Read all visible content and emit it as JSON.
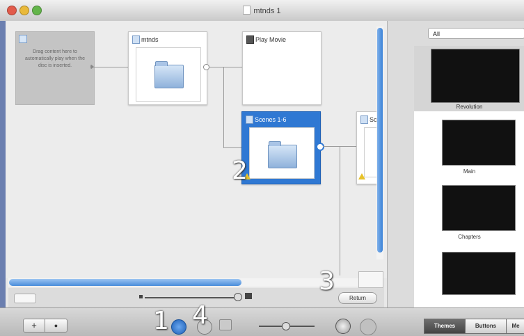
{
  "window": {
    "title": "mtnds 1"
  },
  "graph": {
    "placeholder_text": "Drag content here to automatically play when the disc is inserted.",
    "nodes": [
      {
        "label": "mtnds"
      },
      {
        "label": "Play Movie"
      },
      {
        "label": "Scenes 1-6"
      },
      {
        "label": "Sc"
      }
    ],
    "overlay_numbers": [
      "1",
      "2",
      "3",
      "4"
    ]
  },
  "zoombar": {
    "return_label": "Return"
  },
  "panel": {
    "filter_value": "All",
    "themes": [
      {
        "name": "Revolution"
      },
      {
        "name": "Main"
      },
      {
        "name": "Chapters"
      },
      {
        "name": ""
      }
    ]
  },
  "bottombar": {
    "add_label": "+",
    "segments": [
      {
        "label": "Themes",
        "active": true
      },
      {
        "label": "Buttons",
        "active": false
      },
      {
        "label": "Me",
        "active": false
      }
    ]
  },
  "colors": {
    "accent": "#2f78d3",
    "warning": "#e7c22a",
    "scroll": "#4a8ddb"
  }
}
